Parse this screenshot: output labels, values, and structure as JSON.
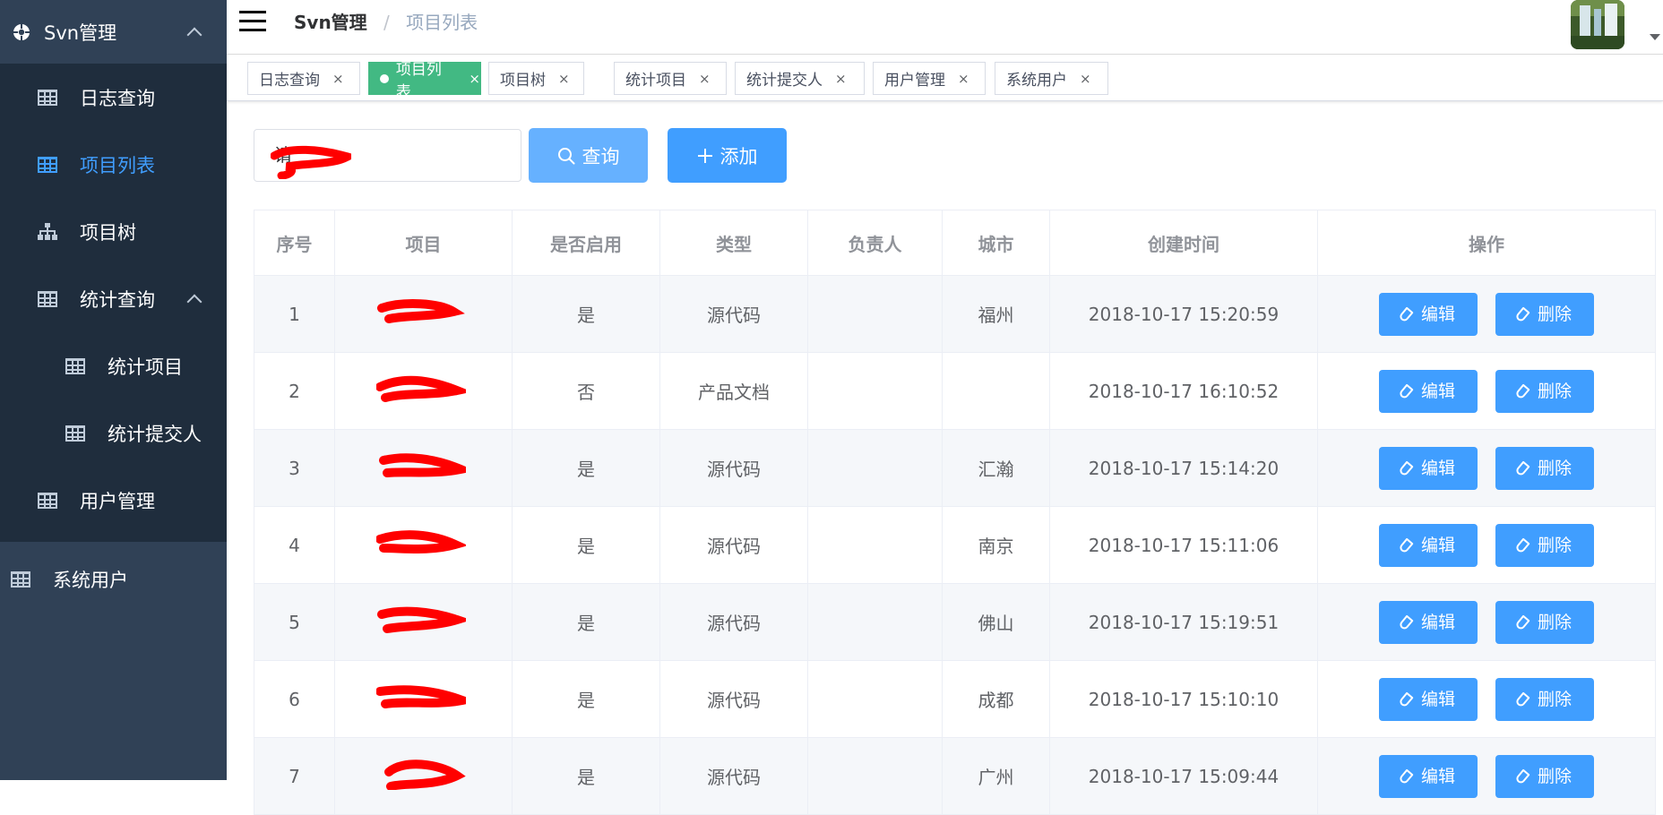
{
  "sidebar": {
    "title": "Svn管理",
    "items": [
      {
        "label": "日志查询"
      },
      {
        "label": "项目列表",
        "active": true
      },
      {
        "label": "项目树"
      },
      {
        "label": "统计查询"
      },
      {
        "label": "统计项目"
      },
      {
        "label": "统计提交人"
      },
      {
        "label": "用户管理"
      }
    ],
    "bottom_item": "系统用户"
  },
  "navbar": {
    "breadcrumb": [
      "Svn管理",
      "项目列表"
    ],
    "separator": "/"
  },
  "tabs": [
    {
      "label": "日志查询"
    },
    {
      "label": "项目列表",
      "active": true
    },
    {
      "label": "项目树"
    },
    {
      "label": "统计项目"
    },
    {
      "label": "统计提交人"
    },
    {
      "label": "用户管理"
    },
    {
      "label": "系统用户"
    }
  ],
  "tab_close": "×",
  "filter": {
    "input_value": "请",
    "query_label": "查询",
    "add_label": "添加"
  },
  "table": {
    "headers": [
      "序号",
      "项目",
      "是否启用",
      "类型",
      "负责人",
      "城市",
      "创建时间",
      "操作"
    ],
    "rows": [
      {
        "no": "1",
        "project": "",
        "enabled": "是",
        "type": "源代码",
        "owner": "",
        "city": "福州",
        "created": "2018-10-17 15:20:59"
      },
      {
        "no": "2",
        "project": "",
        "enabled": "否",
        "type": "产品文档",
        "owner": "",
        "city": "",
        "created": "2018-10-17 16:10:52"
      },
      {
        "no": "3",
        "project": "",
        "enabled": "是",
        "type": "源代码",
        "owner": "",
        "city": "汇瀚",
        "created": "2018-10-17 15:14:20"
      },
      {
        "no": "4",
        "project": "",
        "enabled": "是",
        "type": "源代码",
        "owner": "",
        "city": "南京",
        "created": "2018-10-17 15:11:06"
      },
      {
        "no": "5",
        "project": "",
        "enabled": "是",
        "type": "源代码",
        "owner": "",
        "city": "佛山",
        "created": "2018-10-17 15:19:51"
      },
      {
        "no": "6",
        "project": "",
        "enabled": "是",
        "type": "源代码",
        "owner": "",
        "city": "成都",
        "created": "2018-10-17 15:10:10"
      },
      {
        "no": "7",
        "project": "",
        "enabled": "是",
        "type": "源代码",
        "owner": "",
        "city": "广州",
        "created": "2018-10-17 15:09:44"
      }
    ],
    "edit_label": "编辑",
    "delete_label": "删除"
  },
  "colors": {
    "sidebar_bg": "#304156",
    "submenu_bg": "#1f2d3d",
    "active_menu": "#409eff",
    "active_tab": "#42b983",
    "primary": "#409eff",
    "redaction": "#ff0000"
  }
}
